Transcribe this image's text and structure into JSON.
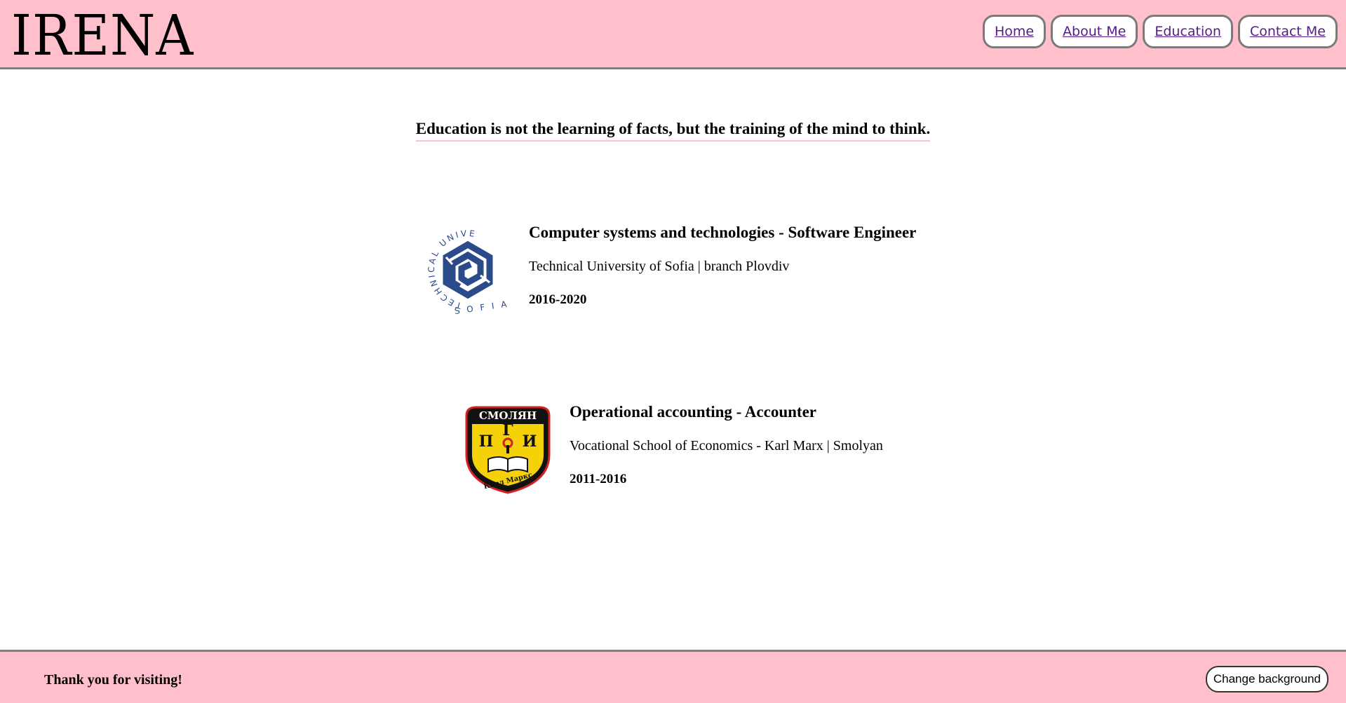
{
  "header": {
    "logo": "IRENA",
    "nav": [
      {
        "label": "Home"
      },
      {
        "label": "About Me"
      },
      {
        "label": "Education"
      },
      {
        "label": "Contact Me"
      }
    ]
  },
  "main": {
    "quote": "Education is not the learning of facts, but the training of the mind to think.",
    "education": [
      {
        "title": "Computer systems and technologies - Software Engineer",
        "school": "Technical University of Sofia | branch Plovdiv",
        "years": "2016-2020",
        "logo": "Technical University Sofia seal"
      },
      {
        "title": "Operational accounting - Accounter",
        "school": "Vocational School of Economics - Karl Marx | Smolyan",
        "years": "2011-2016",
        "logo": "Smolyan vocational school crest",
        "logo_text": "СМОЛЯН ПГИ Карл Маркс"
      }
    ]
  },
  "footer": {
    "thanks": "Thank you for visiting!",
    "button": "Change background"
  },
  "colors": {
    "header_bg": "#ffc0cb",
    "border": "#808080",
    "link": "#551a8b",
    "tu_blue": "#2b4a8a",
    "crest_yellow": "#f5d10a"
  }
}
